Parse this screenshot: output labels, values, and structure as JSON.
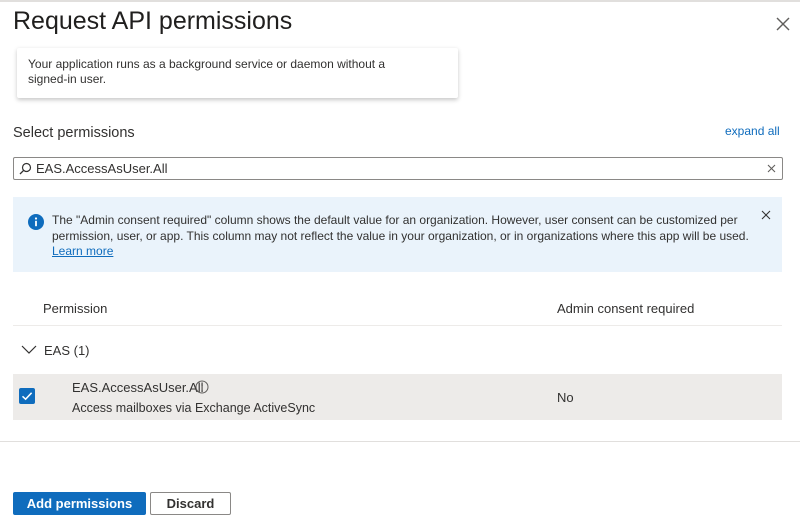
{
  "dialog": {
    "title": "Request API permissions"
  },
  "card": {
    "text": "Your application runs as a background service or daemon without a signed-in user."
  },
  "select_permissions": {
    "title": "Select permissions",
    "expand_all": "expand all"
  },
  "search": {
    "value": "EAS.AccessAsUser.All",
    "placeholder": ""
  },
  "info_bar": {
    "text": "The \"Admin consent required\" column shows the default value for an organization. However, user consent can be customized per permission, user, or app. This column may not reflect the value in your organization, or in organizations where this app will be used.",
    "link": "Learn more"
  },
  "table": {
    "columns": [
      "Permission",
      "Admin consent required"
    ],
    "group": {
      "label": "EAS (1)",
      "expanded": true
    },
    "rows": [
      {
        "name": "EAS.AccessAsUser.All",
        "description": "Access mailboxes via Exchange ActiveSync",
        "admin_consent": "No",
        "checked": true
      }
    ]
  },
  "footer": {
    "primary_label": "Add permissions",
    "secondary_label": "Discard"
  },
  "icons": {
    "close": "close-icon",
    "search": "search-icon",
    "clear": "clear-icon",
    "info": "info-icon",
    "chevron": "chevron-down-icon",
    "checkmark": "checkmark-icon"
  },
  "colors": {
    "accent": "#0f6cbd",
    "info_background": "#eaf3fb",
    "selected_row": "#edebe9"
  }
}
